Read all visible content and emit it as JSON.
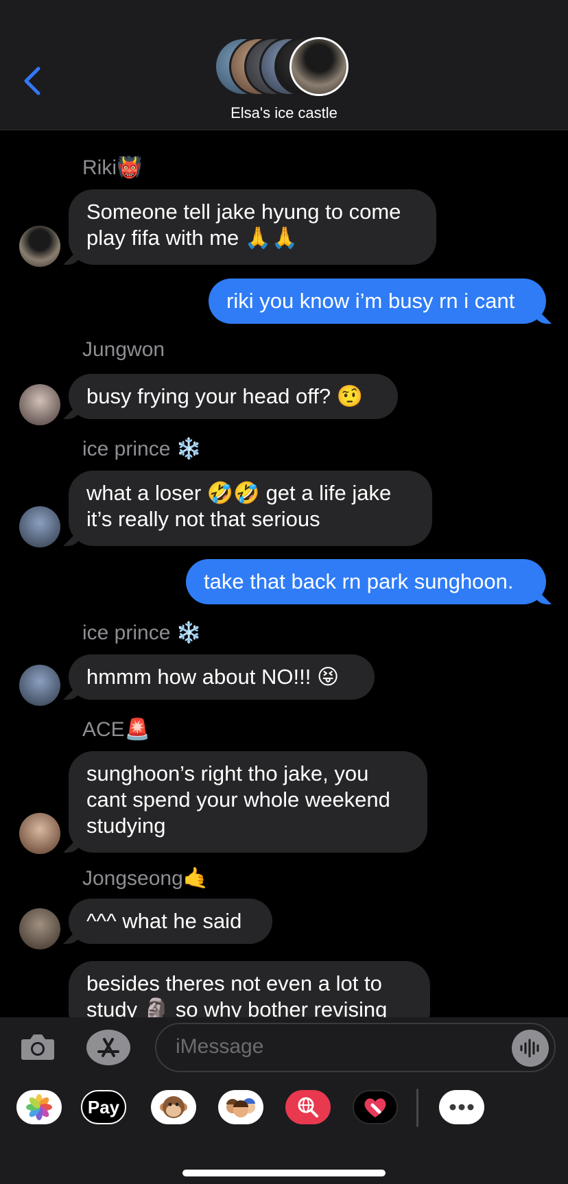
{
  "header": {
    "title": "Elsa's ice castle"
  },
  "messages": [
    {
      "sender": "Riki",
      "sender_emoji": "👹",
      "lines": [
        "Someone tell jake hyung to come",
        "play fifa with me 🙏🙏"
      ]
    },
    {
      "outgoing": true,
      "lines": [
        "riki you know i’m busy rn i cant"
      ]
    },
    {
      "sender": "Jungwon",
      "lines": [
        "busy frying your head off? 🤨"
      ]
    },
    {
      "sender": "ice prince",
      "sender_emoji": "❄️",
      "lines": [
        "what a loser 🤣🤣 get a life jake",
        "it’s really not that serious"
      ]
    },
    {
      "outgoing": true,
      "lines": [
        "take that back rn park sunghoon."
      ]
    },
    {
      "sender": "ice prince",
      "sender_emoji": "❄️",
      "lines": [
        "hmmm how about NO!!! 😝"
      ]
    },
    {
      "sender": "ACE",
      "sender_emoji": "🚨",
      "lines": [
        "sunghoon’s right tho jake, you",
        "cant spend your whole weekend",
        "studying"
      ]
    },
    {
      "sender": "Jongseong",
      "sender_emoji": "🤙",
      "lines": [
        "^^^ what he said"
      ]
    },
    {
      "lines": [
        "besides theres not even a lot to",
        "study 🗿 so why bother revising"
      ]
    }
  ],
  "input": {
    "placeholder": "iMessage"
  },
  "apps": [
    "photos-icon",
    "Pay",
    "animoji-icon",
    "memoji-icon",
    "search-images-icon",
    "digital-touch-icon",
    "more-icon"
  ],
  "colors": {
    "outgoing": "#2f7cf6",
    "incoming": "#262628",
    "accent": "#3478f6"
  }
}
